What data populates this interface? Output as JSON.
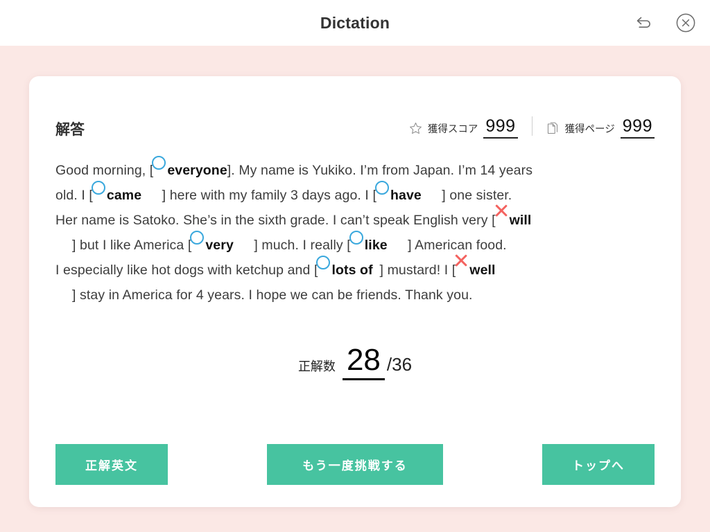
{
  "header": {
    "title": "Dictation",
    "undo_icon": "undo-icon",
    "close_icon": "close-circle-icon"
  },
  "card": {
    "title": "解答",
    "stats": [
      {
        "icon": "star-icon",
        "label": "獲得スコア",
        "value": "999"
      },
      {
        "icon": "pages-icon",
        "label": "獲得ページ",
        "value": "999"
      }
    ]
  },
  "passage": {
    "lines": [
      {
        "indent": false,
        "parts": [
          {
            "t": "text",
            "v": "Good morning, ["
          },
          {
            "t": "answer",
            "mark": "o",
            "v": "everyone",
            "pad": ""
          },
          {
            "t": "text",
            "v": "]. My name is Yukiko. I’m from Japan. I’m 14 years"
          }
        ]
      },
      {
        "indent": false,
        "parts": [
          {
            "t": "text",
            "v": "old. I  ["
          },
          {
            "t": "answer",
            "mark": "o",
            "v": "came",
            "pad": "  "
          },
          {
            "t": "text",
            "v": "] here with my family 3 days ago. I ["
          },
          {
            "t": "answer",
            "mark": "o",
            "v": "have",
            "pad": "  "
          },
          {
            "t": "text",
            "v": "] one sister."
          }
        ]
      },
      {
        "indent": false,
        "parts": [
          {
            "t": "text",
            "v": "Her name is Satoko. She’s in the sixth grade. I can’t speak English very ["
          },
          {
            "t": "answer",
            "mark": "x",
            "v": "will",
            "pad": ""
          }
        ]
      },
      {
        "indent": true,
        "parts": [
          {
            "t": "text",
            "v": "] but I like America ["
          },
          {
            "t": "answer",
            "mark": "o",
            "v": "very",
            "pad": "  "
          },
          {
            "t": "text",
            "v": "] much. I really ["
          },
          {
            "t": "answer",
            "mark": "o",
            "v": "like",
            "pad": "  "
          },
          {
            "t": "text",
            "v": "] American food."
          }
        ]
      },
      {
        "indent": false,
        "parts": [
          {
            "t": "text",
            "v": "I especially like hot dogs with ketchup and ["
          },
          {
            "t": "answer",
            "mark": "o",
            "v": "lots of",
            "pad": " "
          },
          {
            "t": "text",
            "v": "] mustard! I ["
          },
          {
            "t": "answer",
            "mark": "x",
            "v": "well",
            "pad": ""
          }
        ]
      },
      {
        "indent": true,
        "parts": [
          {
            "t": "text",
            "v": "] stay in America for 4 years. I hope we can be friends. Thank you."
          }
        ]
      }
    ]
  },
  "result": {
    "label": "正解数",
    "correct": "28",
    "total": "/36"
  },
  "buttons": {
    "left": "正解英文",
    "center": "もう一度挑戦する",
    "right": "トップへ"
  },
  "colors": {
    "background": "#fbe8e5",
    "card": "#ffffff",
    "button": "#47c3a0",
    "correct_mark": "#3aa8dd",
    "wrong_mark": "#f4625f",
    "text": "#3d3d3d"
  }
}
